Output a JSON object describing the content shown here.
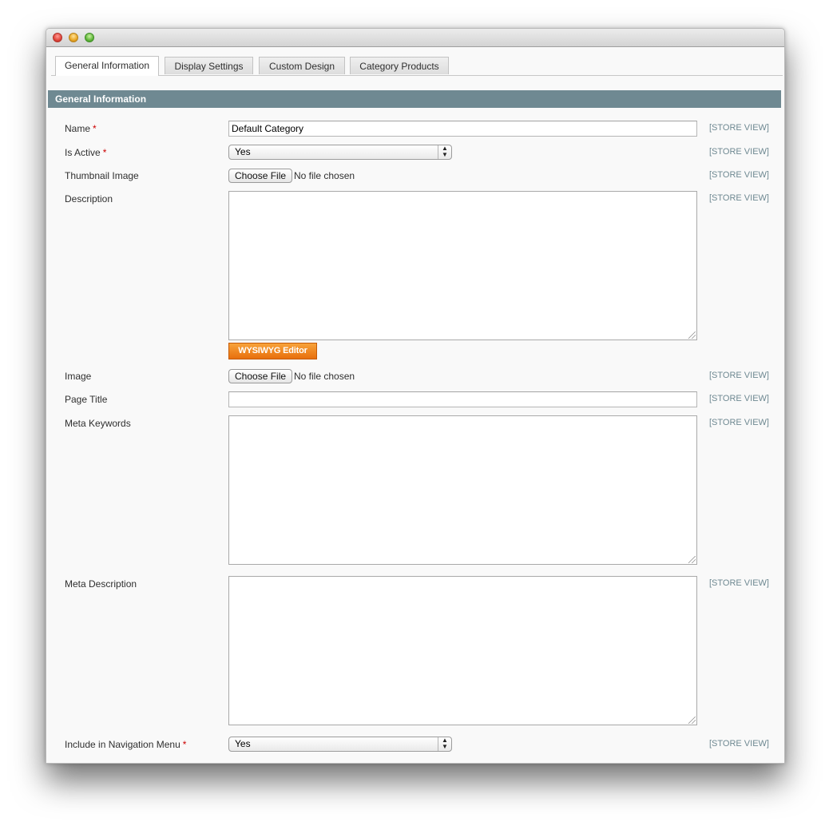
{
  "tabs": [
    {
      "label": "General Information",
      "active": true
    },
    {
      "label": "Display Settings",
      "active": false
    },
    {
      "label": "Custom Design",
      "active": false
    },
    {
      "label": "Category Products",
      "active": false
    }
  ],
  "section": {
    "title": "General Information"
  },
  "scope_label": "[STORE VIEW]",
  "required_marker": "*",
  "file_button_label": "Choose File",
  "file_status": "No file chosen",
  "fields": {
    "name": {
      "label": "Name",
      "value": "Default Category"
    },
    "is_active": {
      "label": "Is Active",
      "value": "Yes"
    },
    "thumbnail": {
      "label": "Thumbnail Image"
    },
    "description": {
      "label": "Description",
      "editor_button": "WYSIWYG Editor"
    },
    "image": {
      "label": "Image"
    },
    "page_title": {
      "label": "Page Title",
      "value": ""
    },
    "meta_keywords": {
      "label": "Meta Keywords"
    },
    "meta_description": {
      "label": "Meta Description"
    },
    "include_in_nav": {
      "label": "Include in Navigation Menu",
      "value": "Yes"
    }
  },
  "colors": {
    "section_header": "#6f8992",
    "scope_text": "#6f8992",
    "required": "#cc0000",
    "wysiwyg_button": "#f08a24"
  }
}
